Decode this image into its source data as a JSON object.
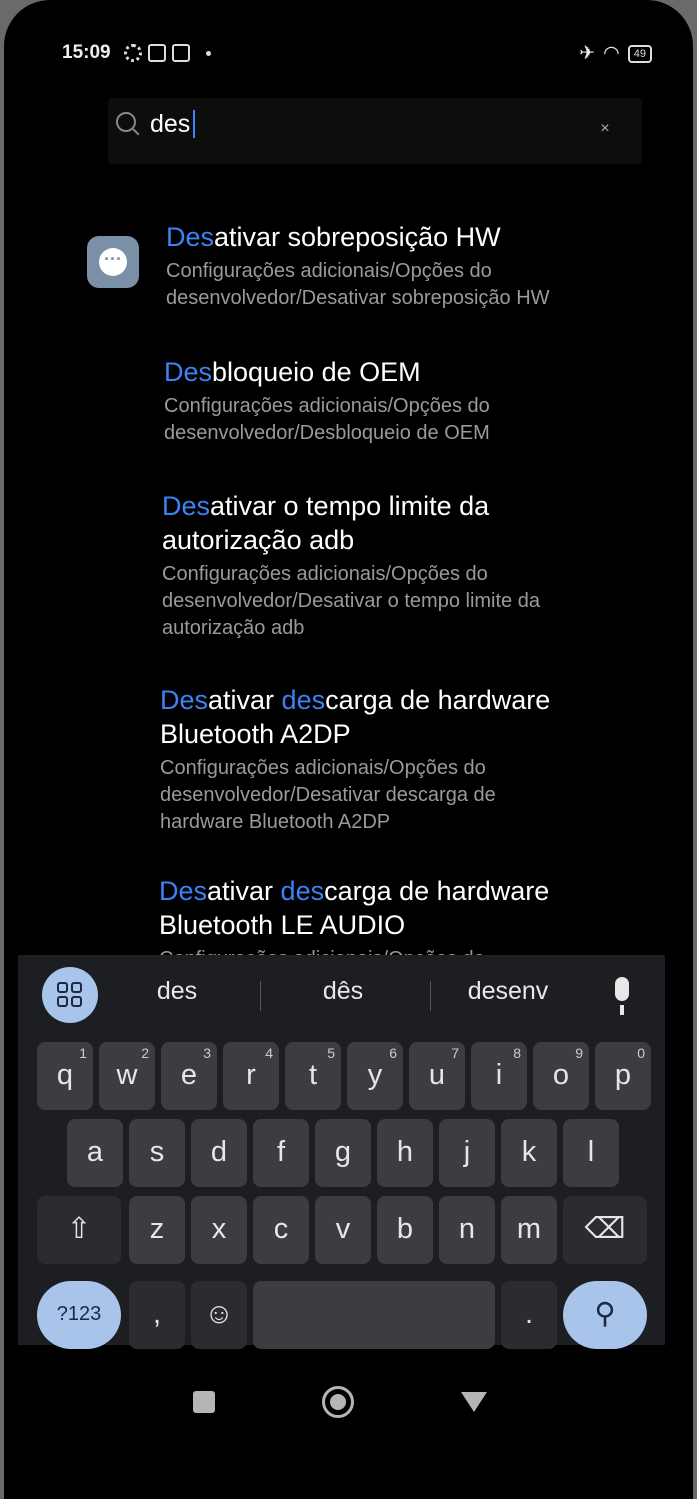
{
  "status_bar": {
    "time": "15:09",
    "battery": "49"
  },
  "search": {
    "query": "des",
    "clear_label": "×"
  },
  "results": [
    {
      "hl": "Des",
      "title_rest": "ativar sobreposição HW",
      "path1": "Configurações adicionais/Opções do",
      "path2": "desenvolvedor/Desativar sobreposição HW"
    },
    {
      "hl": "Des",
      "title_rest": "bloqueio de OEM",
      "path1": "Configurações adicionais/Opções do",
      "path2": "desenvolvedor/Desbloqueio de OEM"
    },
    {
      "hl": "Des",
      "title_l1_rest": "ativar o tempo limite da",
      "title_l2": "autorização adb",
      "path1": "Configurações adicionais/Opções do",
      "path2": "desenvolvedor/Desativar o tempo limite da",
      "path3": "autorização adb"
    },
    {
      "hl": "Des",
      "t_a": "ativar ",
      "hl2": "des",
      "t_b": "carga de hardware",
      "title_l2": "Bluetooth A2DP",
      "path1": "Configurações adicionais/Opções do",
      "path2": "desenvolvedor/Desativar descarga de",
      "path3": "hardware Bluetooth A2DP"
    },
    {
      "hl": "Des",
      "t_a": "ativar ",
      "hl2": "des",
      "t_b": "carga de hardware",
      "title_l2": "Bluetooth LE AUDIO",
      "path1": "Configurações adicionais/Opções do"
    }
  ],
  "suggestions": [
    "des",
    "dês",
    "desenv"
  ],
  "keyboard": {
    "row1": [
      {
        "k": "q",
        "n": "1"
      },
      {
        "k": "w",
        "n": "2"
      },
      {
        "k": "e",
        "n": "3"
      },
      {
        "k": "r",
        "n": "4"
      },
      {
        "k": "t",
        "n": "5"
      },
      {
        "k": "y",
        "n": "6"
      },
      {
        "k": "u",
        "n": "7"
      },
      {
        "k": "i",
        "n": "8"
      },
      {
        "k": "o",
        "n": "9"
      },
      {
        "k": "p",
        "n": "0"
      }
    ],
    "row2": [
      "a",
      "s",
      "d",
      "f",
      "g",
      "h",
      "j",
      "k",
      "l"
    ],
    "row3": [
      "z",
      "x",
      "c",
      "v",
      "b",
      "n",
      "m"
    ],
    "symbols": "?123",
    "comma": ",",
    "period": ".",
    "shift_glyph": "⇧",
    "backspace_glyph": "⌫",
    "emoji_glyph": "☺",
    "search_glyph": "⚲"
  }
}
